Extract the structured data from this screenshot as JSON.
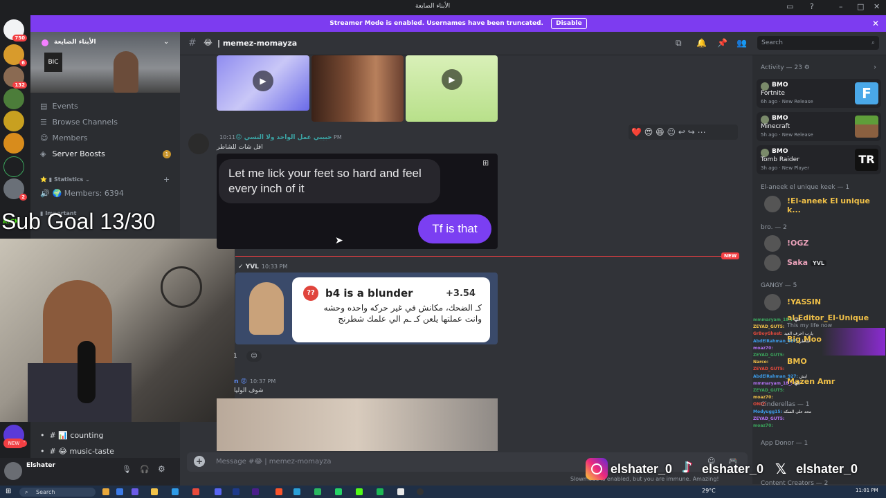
{
  "window": {
    "title": "الأبناء الضايعة"
  },
  "banner": {
    "text": "Streamer Mode is enabled. Usernames have been truncated.",
    "disable_label": "Disable"
  },
  "rail": {
    "badges": [
      "750",
      "6",
      "132",
      "2",
      "2",
      "17",
      "3K+",
      "NEW"
    ],
    "kick_label": "KICK"
  },
  "sidebar": {
    "server_name": "الأبناء الضايعة",
    "items": [
      "Events",
      "Browse Channels",
      "Members",
      "Server Boosts"
    ],
    "boost_badge": "1",
    "category_statistics": "Statistics",
    "members_count": "Members: 6394",
    "category_important": "Important",
    "bottom_channels": [
      "counting",
      "music-taste"
    ]
  },
  "overlay": {
    "sub_goal": "Sub Goal 13/30"
  },
  "header": {
    "channel": "| memez-momayza",
    "search_placeholder": "Search"
  },
  "messages": {
    "m1": {
      "author": "حبيبي عمل الواحد ولا التسي",
      "time": "10:11 PM",
      "subtitle": "اقل شات للشاطر"
    },
    "chat_bubble_1": "Let me lick your feet so hard and feel every inch of it",
    "chat_bubble_2": "Tf is that",
    "m2": {
      "author": "YVL",
      "time": "10:33 PM"
    },
    "chess": {
      "title": "b4 is a blunder",
      "score": "+3.54",
      "body": "كـ الضحك، مكانش في غير حركه واحده وحشه وانت عملتها يلعن كـ ـم الي علمك شطرنج"
    },
    "reactions_count": "1",
    "m3": {
      "author": "n",
      "time": "10:37 PM",
      "subtitle": "شوف الوليا"
    },
    "new_label": "NEW"
  },
  "composer": {
    "placeholder": "Message #😂 | memez-momayza",
    "slowmode": "Slowmode is enabled, but you are immune. Amazing!"
  },
  "activity": {
    "header": "Activity — 23",
    "cards": [
      {
        "user": "BMO",
        "game": "Fortnite",
        "meta": "6h ago · New Release"
      },
      {
        "user": "BMO",
        "game": "Minecraft",
        "meta": "5h ago · New Release"
      },
      {
        "user": "BMO",
        "game": "Tomb Raider",
        "meta": "3h ago · New Player"
      }
    ]
  },
  "members": {
    "groups": [
      {
        "label": "El-aneek el unique keek — 1",
        "members": [
          "!El-aneek El unique k..."
        ]
      },
      {
        "label": "bro. — 2",
        "members": [
          "!OGZ",
          "Saka"
        ]
      },
      {
        "label": "GANGY — 5",
        "members": [
          "!YASSIN",
          "al-Editor_El-Unique",
          "Big Moo",
          "BMO",
          "Mazen Amr"
        ]
      }
    ],
    "saka_tag": "YVL",
    "extra_groups": [
      "Cinderellas — 1",
      "App Donor — 1",
      "Content Creators — 2"
    ],
    "big_moo_status": "This my life now"
  },
  "stream_chat": [
    {
      "user": "mmmaryam_18_",
      "msg": "كلها"
    },
    {
      "user": "ZEYAD_GUT5",
      "msg": ""
    },
    {
      "user": "GrBoyGhost",
      "msg": "يارب احرف العيد"
    },
    {
      "user": "AbdElRahman_927",
      "msg": "شاطر"
    },
    {
      "user": "moaz70",
      "msg": ""
    },
    {
      "user": "ZEYAD_GUT5",
      "msg": ""
    },
    {
      "user": "Narco",
      "msg": ""
    },
    {
      "user": "ZEYAD_GUT5",
      "msg": ""
    },
    {
      "user": "AbdElRahman_927",
      "msg": "ايش"
    },
    {
      "user": "mmmaryam_18_",
      "msg": "كلها"
    },
    {
      "user": "ZEYAD_GUT5",
      "msg": ""
    },
    {
      "user": "moaz70",
      "msg": ""
    },
    {
      "user": "ONLY",
      "msg": ""
    },
    {
      "user": "Modyugg15",
      "msg": "محد على السكه"
    },
    {
      "user": "ZEYAD_GUT5",
      "msg": ""
    },
    {
      "user": "moaz70",
      "msg": ""
    }
  ],
  "social": {
    "instagram": "elshater_0",
    "tiktok": "elshater_0",
    "x": "elshater_0"
  },
  "user_panel": {
    "name": "Elshater"
  },
  "taskbar": {
    "search": "Search",
    "weather": "29°C",
    "time": "11:01 PM"
  },
  "colors": {
    "accent": "#7d3cf0",
    "new_divider": "#f23f43",
    "blurple": "#5865f2",
    "bubble": "#7b3ff2"
  }
}
